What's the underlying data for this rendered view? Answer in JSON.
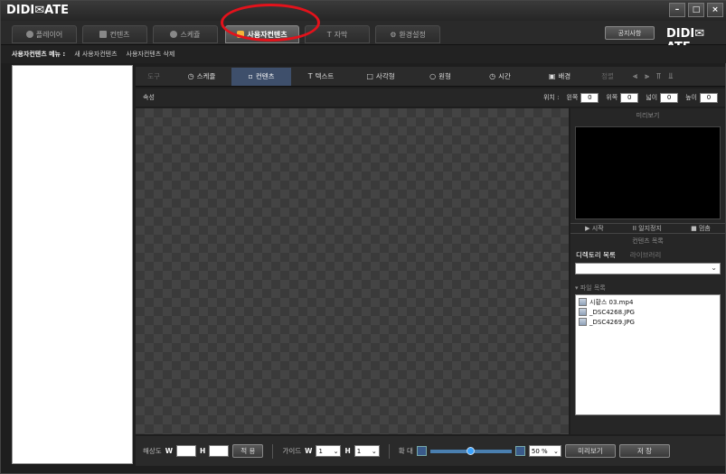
{
  "app": {
    "logo": "DIDI✉ATE",
    "brand": "DIDI✉ATE"
  },
  "window": {
    "minimize": "–",
    "maximize": "□",
    "close": "×"
  },
  "main_tabs": [
    {
      "label": "플레이어",
      "icon": "circle-icon"
    },
    {
      "label": "컨텐츠",
      "icon": "grid-icon"
    },
    {
      "label": "스케쥴",
      "icon": "clock-icon"
    },
    {
      "label": "사용자컨텐츠",
      "icon": "user-icon",
      "active": true
    },
    {
      "label": "자막",
      "icon": "text-icon"
    },
    {
      "label": "환경설정",
      "icon": "settings-icon"
    }
  ],
  "notice_button": "공지사항",
  "submenu": {
    "title": "사용자컨텐츠 메뉴 :",
    "new": "새 사용자컨텐츠",
    "delete": "사용자컨텐츠 삭제"
  },
  "toolbar": {
    "tool": "도구",
    "schedule": "스케쥴",
    "content": "컨텐츠",
    "text": "텍스트",
    "rect": "사각형",
    "circle": "원형",
    "time": "시간",
    "background": "배경",
    "align": "정렬"
  },
  "props": {
    "label": "속성",
    "position": "위치 :",
    "left_label": "왼쪽",
    "left_value": "0",
    "top_label": "위쪽",
    "top_value": "0",
    "width_label": "넓이",
    "width_value": "0",
    "height_label": "높이",
    "height_value": "0"
  },
  "right": {
    "preview_title": "미리보기",
    "play": "▶ 시작",
    "pause": "II 일지정지",
    "stop": "■ 멈춤",
    "content_list": "컨텐츠 목록",
    "dir_tab": "디렉토리 목록",
    "lib_tab": "라이브러리",
    "file_header": "▾ 파일 목록",
    "files": [
      "시황스 03.mp4",
      "_DSC4268.JPG",
      "_DSC4269.JPG"
    ]
  },
  "bottom": {
    "resolution": "해상도",
    "w": "W",
    "h": "H",
    "apply": "적 용",
    "guide": "가이드",
    "guide_w": "W",
    "guide_w_value": "1",
    "guide_h": "H",
    "guide_h_value": "1",
    "zoom": "확 대",
    "zoom_value": "50 %",
    "preview": "미리보기",
    "save": "저 장"
  }
}
